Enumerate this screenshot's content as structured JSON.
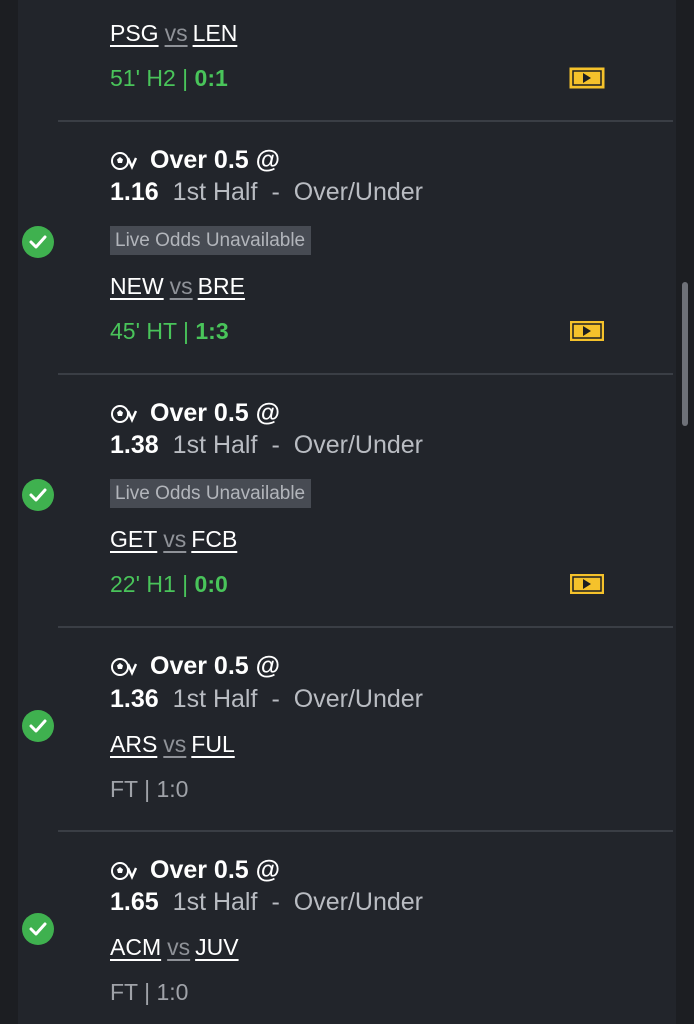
{
  "items": [
    {
      "home": "PSG",
      "vs": "vs",
      "away": "LEN",
      "time": "51' H2 | ",
      "score": "0:1",
      "live": true
    },
    {
      "market_title": "Over 0.5 @",
      "odds": "1.16",
      "period": "1st Half",
      "dash": "-",
      "market": "Over/Under",
      "badge": "Live Odds Unavailable",
      "home": "NEW",
      "vs": "vs",
      "away": "BRE",
      "time": "45' HT | ",
      "score": "1:3",
      "live": true
    },
    {
      "market_title": "Over 0.5 @",
      "odds": "1.38",
      "period": "1st Half",
      "dash": "-",
      "market": "Over/Under",
      "badge": "Live Odds Unavailable",
      "home": "GET",
      "vs": "vs",
      "away": "FCB",
      "time": "22' H1 | ",
      "score": "0:0",
      "live": true
    },
    {
      "market_title": "Over 0.5 @",
      "odds": "1.36",
      "period": "1st Half",
      "dash": "-",
      "market": "Over/Under",
      "home": "ARS",
      "vs": "vs",
      "away": "FUL",
      "status": "FT | 1:0",
      "live": false
    },
    {
      "market_title": "Over 0.5 @",
      "odds": "1.65",
      "period": "1st Half",
      "dash": "-",
      "market": "Over/Under",
      "home": "ACM",
      "vs": "vs",
      "away": "JUV",
      "status": "FT | 1:0",
      "live": false
    }
  ],
  "icons": {
    "sport": "soccer-ball-icon",
    "result": "check-circle-icon",
    "stream": "live-stream-icon"
  },
  "colors": {
    "background": "#22252b",
    "live_green": "#49c45a",
    "check_green": "#3fb14f",
    "stream_yellow": "#f5c22b"
  }
}
